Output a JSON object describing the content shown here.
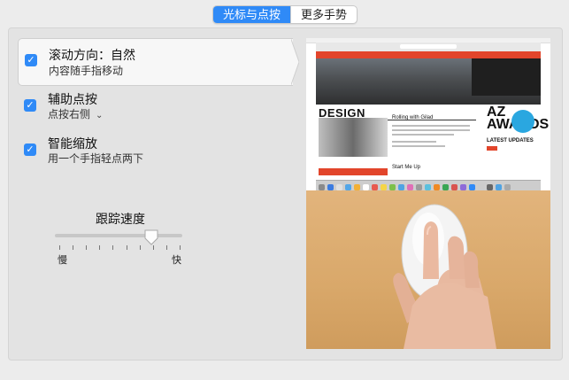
{
  "tabs": [
    {
      "label": "光标与点按",
      "active": true
    },
    {
      "label": "更多手势",
      "active": false
    }
  ],
  "options": [
    {
      "title": "滚动方向：自然",
      "subtitle": "内容随手指移动",
      "checked": true,
      "selected": true
    },
    {
      "title": "辅助点按",
      "subtitle": "点按右侧",
      "checked": true,
      "has_menu": true
    },
    {
      "title": "智能缩放",
      "subtitle": "用一个手指轻点两下",
      "checked": true
    }
  ],
  "tracking": {
    "title": "跟踪速度",
    "min_label": "慢",
    "max_label": "快",
    "value_fraction": 0.76,
    "tick_count": 10
  },
  "preview": {
    "headline": "DESIGN",
    "article_title": "Rolling with Gilad",
    "second_title": "Start Me Up",
    "awards_logo": "AZ AWARDS",
    "latest_updates": "LATEST UPDATES"
  },
  "colors": {
    "accent": "#2f8af7",
    "site_red": "#e2452b"
  },
  "icons": {
    "check": "checkmark-icon",
    "menu": "chevron-down-icon",
    "slider_thumb": "slider-thumb-icon"
  }
}
